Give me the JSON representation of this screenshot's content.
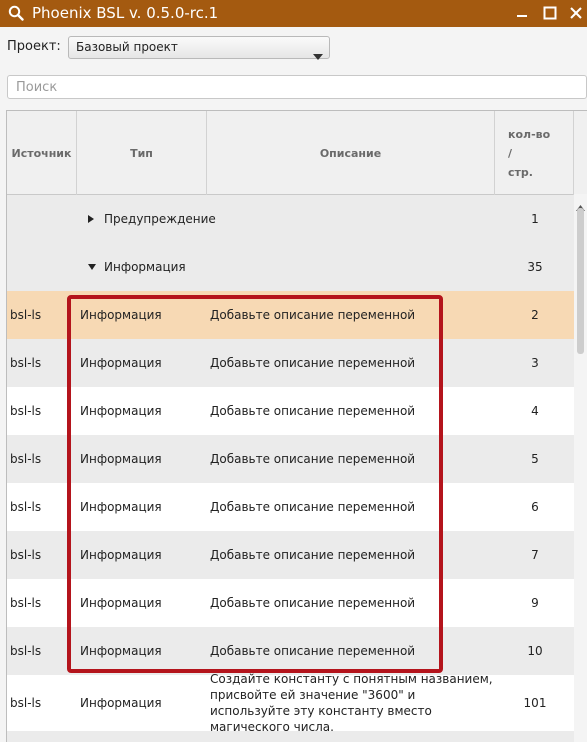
{
  "titlebar": {
    "title": "Phoenix BSL v. 0.5.0-rc.1",
    "icon": "search-icon",
    "minimize": "minimize-icon",
    "maximize": "maximize-icon",
    "close": "close-icon"
  },
  "project": {
    "label": "Проект:",
    "selected": "Базовый проект"
  },
  "search": {
    "placeholder": "Поиск",
    "value": ""
  },
  "table": {
    "columns": {
      "source": "Источник",
      "type": "Тип",
      "description": "Описание",
      "count": "кол-во\n/\nстр."
    },
    "groups": [
      {
        "label": "Предупреждение",
        "count": "1",
        "expanded": false
      },
      {
        "label": "Информация",
        "count": "35",
        "expanded": true
      }
    ],
    "rows": [
      {
        "source": "bsl-ls",
        "type": "Информация",
        "description": "Добавьте описание переменной",
        "count": "2"
      },
      {
        "source": "bsl-ls",
        "type": "Информация",
        "description": "Добавьте описание переменной",
        "count": "3"
      },
      {
        "source": "bsl-ls",
        "type": "Информация",
        "description": "Добавьте описание переменной",
        "count": "4"
      },
      {
        "source": "bsl-ls",
        "type": "Информация",
        "description": "Добавьте описание переменной",
        "count": "5"
      },
      {
        "source": "bsl-ls",
        "type": "Информация",
        "description": "Добавьте описание переменной",
        "count": "6"
      },
      {
        "source": "bsl-ls",
        "type": "Информация",
        "description": "Добавьте описание переменной",
        "count": "7"
      },
      {
        "source": "bsl-ls",
        "type": "Информация",
        "description": "Добавьте описание переменной",
        "count": "9"
      },
      {
        "source": "bsl-ls",
        "type": "Информация",
        "description": "Добавьте описание переменной",
        "count": "10"
      },
      {
        "source": "bsl-ls",
        "type": "Информация",
        "description": "Создайте константу с понятным названием, присвойте ей значение \"3600\" и используйте эту константу вместо магического числа.",
        "count": "101"
      }
    ]
  },
  "colors": {
    "titlebar": "#a45a10",
    "selected_row": "#f7d9b4",
    "highlight_border": "#b4141c"
  }
}
